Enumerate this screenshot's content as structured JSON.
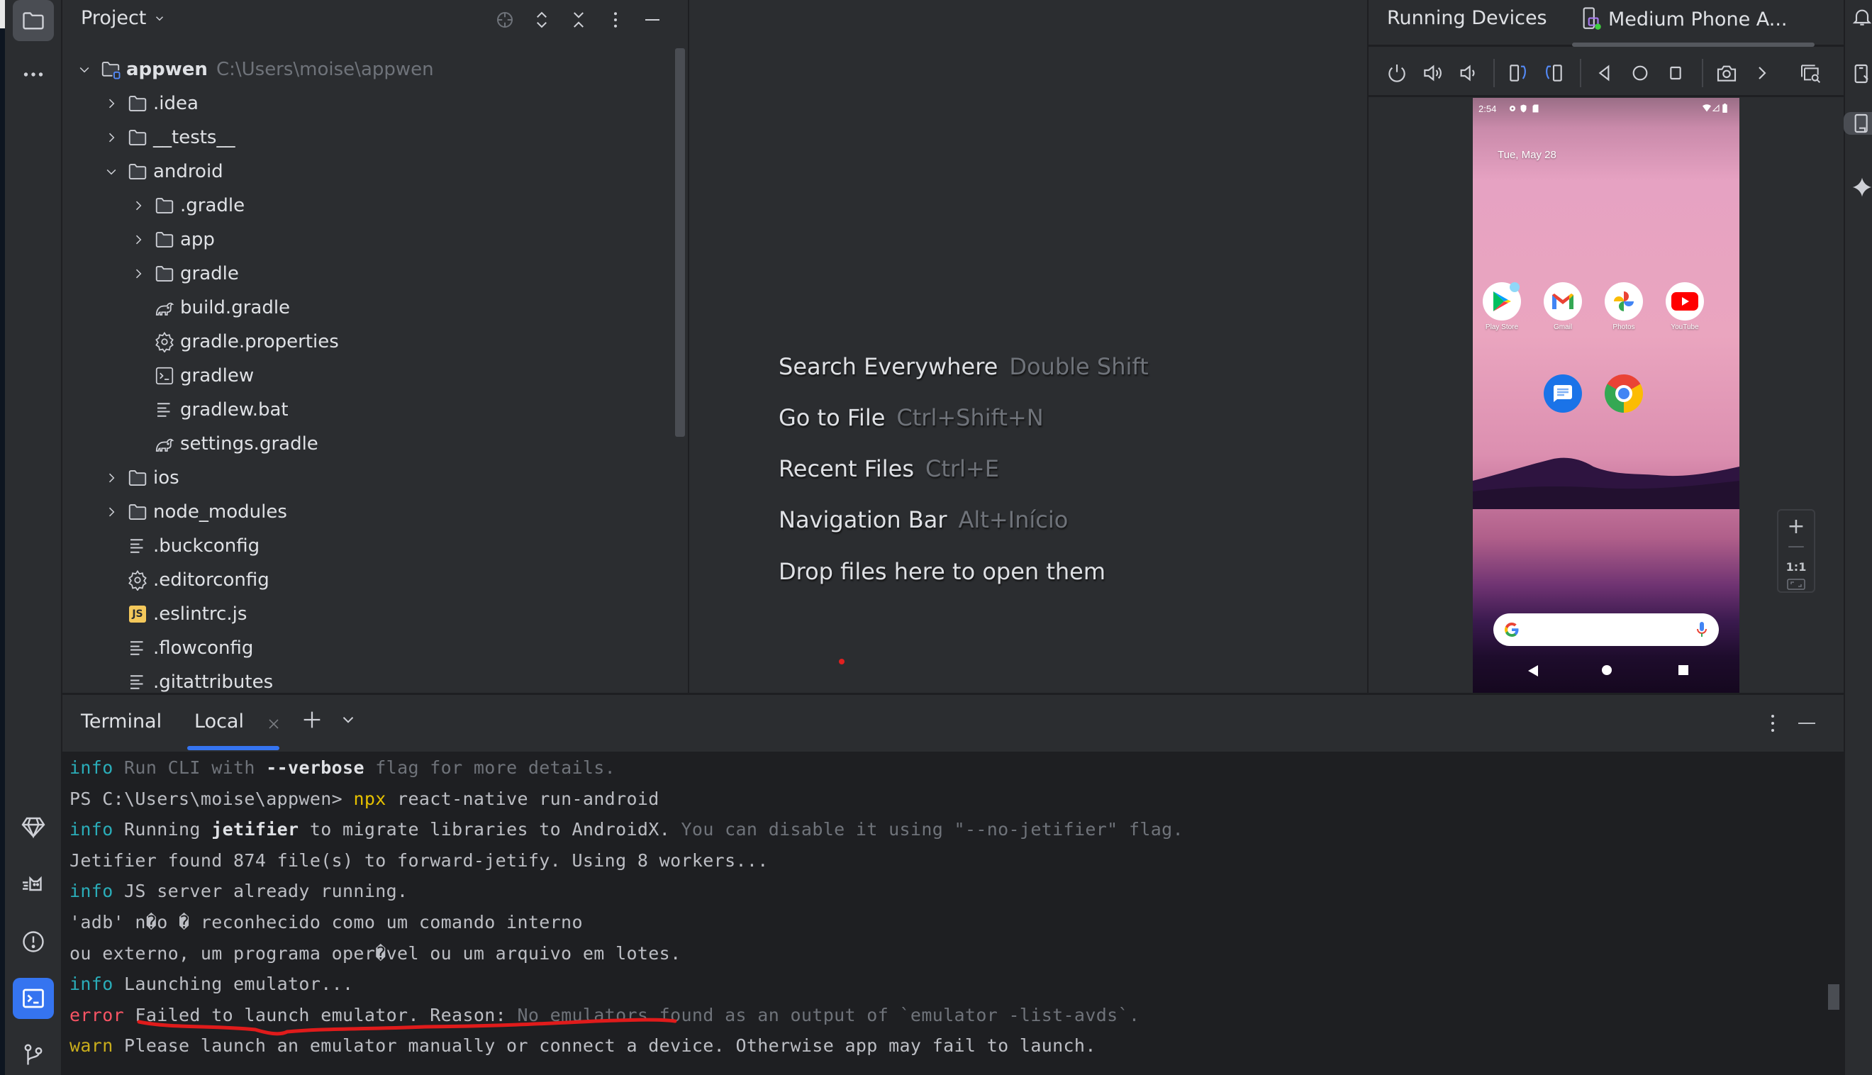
{
  "left_toolbar": {
    "top_items": [
      {
        "name": "project",
        "icon": "folder-icon",
        "active": true
      },
      {
        "name": "more",
        "icon": "more-horizontal-icon"
      }
    ],
    "bottom_items": [
      {
        "name": "gemini-gem",
        "icon": "gem-icon"
      },
      {
        "name": "logcat",
        "icon": "logcat-cat-icon"
      },
      {
        "name": "problems",
        "icon": "warning-circle-icon"
      },
      {
        "name": "terminal",
        "icon": "terminal-icon",
        "active": true
      },
      {
        "name": "version-control",
        "icon": "git-branch-icon"
      }
    ]
  },
  "project_panel": {
    "title": "Project",
    "toolbar": [
      "locate-icon",
      "expand-all-icon",
      "collapse-all-icon",
      "more-vertical-icon",
      "minimize-icon"
    ],
    "tree": [
      {
        "label": "appwen",
        "path": "C:\\Users\\moise\\appwen",
        "level": 0,
        "type": "project",
        "expanded": true
      },
      {
        "label": ".idea",
        "level": 1,
        "type": "folder",
        "expanded": false
      },
      {
        "label": "__tests__",
        "level": 1,
        "type": "folder",
        "expanded": false
      },
      {
        "label": "android",
        "level": 1,
        "type": "folder",
        "expanded": true
      },
      {
        "label": ".gradle",
        "level": 2,
        "type": "folder",
        "expanded": false
      },
      {
        "label": "app",
        "level": 2,
        "type": "folder",
        "expanded": false
      },
      {
        "label": "gradle",
        "level": 2,
        "type": "folder",
        "expanded": false
      },
      {
        "label": "build.gradle",
        "level": 2,
        "type": "gradle"
      },
      {
        "label": "gradle.properties",
        "level": 2,
        "type": "settings"
      },
      {
        "label": "gradlew",
        "level": 2,
        "type": "shell"
      },
      {
        "label": "gradlew.bat",
        "level": 2,
        "type": "text"
      },
      {
        "label": "settings.gradle",
        "level": 2,
        "type": "gradle"
      },
      {
        "label": "ios",
        "level": 1,
        "type": "folder",
        "expanded": false
      },
      {
        "label": "node_modules",
        "level": 1,
        "type": "folder",
        "expanded": false
      },
      {
        "label": ".buckconfig",
        "level": 1,
        "type": "text"
      },
      {
        "label": ".editorconfig",
        "level": 1,
        "type": "settings"
      },
      {
        "label": ".eslintrc.js",
        "level": 1,
        "type": "js"
      },
      {
        "label": ".flowconfig",
        "level": 1,
        "type": "text"
      },
      {
        "label": ".gitattributes",
        "level": 1,
        "type": "text"
      }
    ]
  },
  "editor": {
    "hints": [
      {
        "action": "Search Everywhere",
        "shortcut": "Double Shift"
      },
      {
        "action": "Go to File",
        "shortcut": "Ctrl+Shift+N"
      },
      {
        "action": "Recent Files",
        "shortcut": "Ctrl+E"
      },
      {
        "action": "Navigation Bar",
        "shortcut": "Alt+Início"
      },
      {
        "action": "Drop files here to open them",
        "shortcut": ""
      }
    ]
  },
  "running_devices": {
    "title": "Running Devices",
    "device_tab": "Medium Phone A...",
    "toolbar": [
      "power-icon",
      "volume-up-icon",
      "volume-down-icon",
      "rotate-left-icon",
      "rotate-right-icon",
      "back-icon",
      "home-icon",
      "overview-icon",
      "screenshot-camera-icon",
      "more-chevron-icon",
      "snapshot-search-icon"
    ],
    "zoom_controls": {
      "zoom_in": "+",
      "zoom_out": "—",
      "actual_size": "1:1",
      "fit": "fit-screen-icon"
    },
    "phone": {
      "status_time": "2:54",
      "date": "Tue, May 28",
      "apps": [
        {
          "label": "Play Store"
        },
        {
          "label": "Gmail"
        },
        {
          "label": "Photos"
        },
        {
          "label": "YouTube"
        }
      ],
      "dock": [
        {
          "label": "Messages"
        },
        {
          "label": "Chrome"
        }
      ]
    }
  },
  "right_strip": [
    "notifications-bell-icon",
    "device-manager-icon",
    "running-devices-icon",
    "gemini-sparkle-icon"
  ],
  "terminal": {
    "title": "Terminal",
    "tab_label": "Local",
    "lines": [
      [
        {
          "t": "info",
          "c": "info"
        },
        {
          "t": " Run CLI with ",
          "c": "dim"
        },
        {
          "t": "--verbose",
          "c": "bold"
        },
        {
          "t": " flag for more details.",
          "c": "dim"
        }
      ],
      [
        {
          "t": "PS C:\\Users\\moise\\appwen> ",
          "c": ""
        },
        {
          "t": "npx",
          "c": "yellow"
        },
        {
          "t": " react-native run-android",
          "c": ""
        }
      ],
      [
        {
          "t": "info",
          "c": "info"
        },
        {
          "t": " Running ",
          "c": ""
        },
        {
          "t": "jetifier",
          "c": "bold"
        },
        {
          "t": " to migrate libraries to AndroidX.",
          "c": ""
        },
        {
          "t": " You can disable it using \"--no-jetifier\" flag.",
          "c": "dim"
        }
      ],
      [
        {
          "t": "Jetifier found 874 file(s) to forward-jetify. Using 8 workers...",
          "c": ""
        }
      ],
      [
        {
          "t": "info",
          "c": "info"
        },
        {
          "t": " JS server already running.",
          "c": ""
        }
      ],
      [
        {
          "t": "'adb' n�o � reconhecido como um comando interno",
          "c": ""
        }
      ],
      [
        {
          "t": "ou externo, um programa oper�vel ou um arquivo em lotes.",
          "c": ""
        }
      ],
      [
        {
          "t": "info",
          "c": "info"
        },
        {
          "t": " Launching emulator...",
          "c": ""
        }
      ],
      [
        {
          "t": "error",
          "c": "err"
        },
        {
          "t": " Failed to launch emulator. Reason: ",
          "c": ""
        },
        {
          "t": "No emulators found as an output of `emulator -list-avds`.",
          "c": "dim"
        }
      ],
      [
        {
          "t": "warn",
          "c": "warn"
        },
        {
          "t": " Please launch an emulator manually or connect a device. Otherwise app may fail to launch.",
          "c": ""
        }
      ]
    ]
  }
}
